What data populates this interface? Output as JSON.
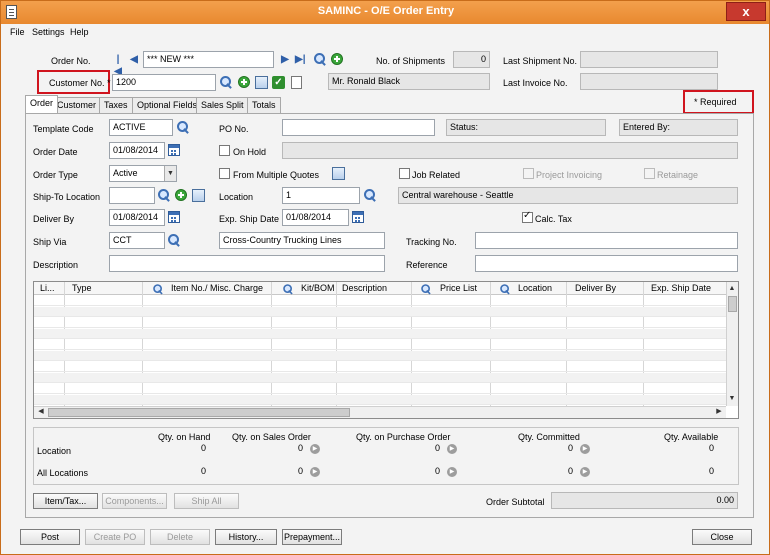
{
  "window": {
    "title": "SAMINC - O/E Order Entry",
    "close_glyph": "x"
  },
  "menu": [
    "File",
    "Settings",
    "Help"
  ],
  "header": {
    "order_no_label": "Order No.",
    "order_no_value": "*** NEW ***",
    "customer_no_label": "Customer No. *",
    "customer_no_value": "1200",
    "customer_name": "Mr. Ronald Black",
    "no_of_shipments_label": "No. of Shipments",
    "no_of_shipments_value": "0",
    "last_shipment_label": "Last Shipment No.",
    "last_shipment_value": "",
    "last_invoice_label": "Last Invoice No.",
    "last_invoice_value": "",
    "required_note": "*  Required"
  },
  "tabs": [
    "Order",
    "Customer",
    "Taxes",
    "Optional Fields",
    "Sales Split",
    "Totals"
  ],
  "order_tab": {
    "template_code_label": "Template Code",
    "template_code_value": "ACTIVE",
    "po_no_label": "PO No.",
    "po_no_value": "",
    "status_label": "Status:",
    "entered_by_label": "Entered By:",
    "order_date_label": "Order Date",
    "order_date_value": "01/08/2014",
    "on_hold_label": "On Hold",
    "on_hold_checked": false,
    "order_type_label": "Order Type",
    "order_type_value": "Active",
    "from_multiple_quotes_label": "From Multiple Quotes",
    "from_multiple_quotes_checked": false,
    "job_related_label": "Job Related",
    "job_related_checked": false,
    "project_invoicing_label": "Project Invoicing",
    "retainage_label": "Retainage",
    "ship_to_location_label": "Ship-To Location",
    "ship_to_location_value": "",
    "location_label": "Location",
    "location_value": "1",
    "location_description": "Central warehouse - Seattle",
    "deliver_by_label": "Deliver By",
    "deliver_by_value": "01/08/2014",
    "exp_ship_date_label": "Exp. Ship Date",
    "exp_ship_date_value": "01/08/2014",
    "calc_tax_label": "Calc. Tax",
    "calc_tax_checked": true,
    "ship_via_label": "Ship Via",
    "ship_via_value": "CCT",
    "ship_via_description": "Cross-Country Trucking Lines",
    "tracking_no_label": "Tracking No.",
    "tracking_no_value": "",
    "description_label": "Description",
    "description_value": "",
    "reference_label": "Reference",
    "reference_value": ""
  },
  "grid": {
    "columns": [
      "Li...",
      "Type",
      "Item No./ Misc. Charge",
      "Kit/BOM",
      "Description",
      "Price List",
      "Location",
      "Deliver By",
      "Exp. Ship Date"
    ],
    "rows": []
  },
  "quantities": {
    "headers": [
      "Qty. on Hand",
      "Qty. on Sales Order",
      "Qty. on Purchase Order",
      "Qty. Committed",
      "Qty. Available"
    ],
    "location_label": "Location",
    "location_values": [
      "0",
      "0",
      "0",
      "0",
      "0"
    ],
    "all_locations_label": "All Locations",
    "all_locations_values": [
      "0",
      "0",
      "0",
      "0",
      "0"
    ]
  },
  "actions": {
    "item_tax": "Item/Tax...",
    "components": "Components...",
    "ship_all": "Ship All",
    "order_subtotal_label": "Order Subtotal",
    "order_subtotal_value": "0.00"
  },
  "footer": {
    "post": "Post",
    "create_po": "Create PO",
    "delete": "Delete",
    "history": "History...",
    "prepayment": "Prepayment...",
    "close": "Close"
  }
}
